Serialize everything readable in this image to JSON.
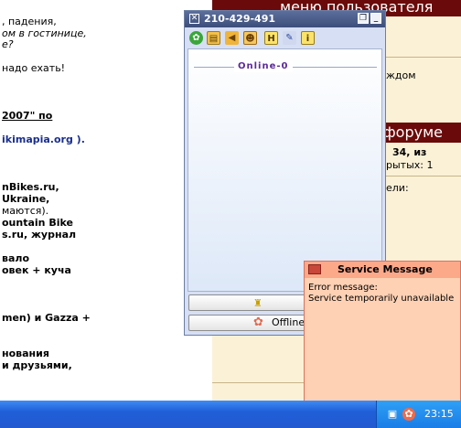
{
  "forum_page": {
    "left_lines": [
      ", падения,",
      "ом в гостинице,",
      "е?",
      "",
      "надо ехать!",
      "2007\" по",
      "ikimapia.org ).",
      "nBikes.ru,",
      "Ukraine,",
      "маются).",
      "ountain Bike",
      "s.ru, журнал",
      "вало",
      "овек + куча",
      "men) и Gazza +",
      "нования",
      "и друзьями,"
    ],
    "right_lines": [
      "меню пользователя",
      "ждом",
      "форуме",
      "34, из",
      "рытых: 1",
      "ели:"
    ]
  },
  "icq": {
    "title": "210-429-491",
    "toolbar_icons": [
      "flower-icon",
      "folder-icon",
      "sound-icon",
      "users-icon",
      "h-icon",
      "tools-icon",
      "info-icon"
    ],
    "online_label": "Online-0",
    "status_label": "Offline"
  },
  "service_message": {
    "title": "Service Message",
    "line1": "Error message:",
    "line2": "Service temporarily unavailable"
  },
  "taskbar": {
    "clock": "23:15"
  },
  "colors": {
    "forum_bar": "#6b0a0a",
    "popup_bg": "#fed1b4",
    "taskbar": "#2459d0"
  }
}
